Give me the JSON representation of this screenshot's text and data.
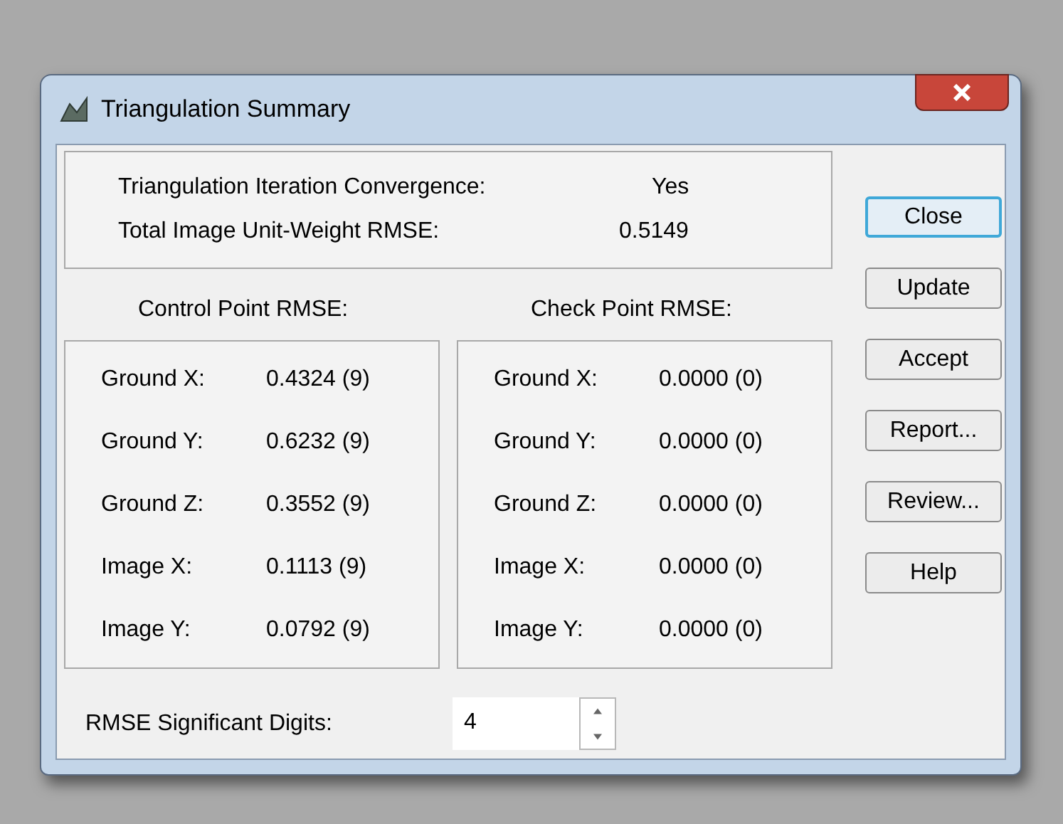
{
  "window": {
    "title": "Triangulation Summary"
  },
  "summary": [
    {
      "label": "Triangulation Iteration Convergence:",
      "value": "Yes"
    },
    {
      "label": "Total Image Unit-Weight RMSE:",
      "value": "0.5149"
    }
  ],
  "groups": [
    {
      "heading": "Control Point RMSE:",
      "rows": [
        {
          "label": "Ground X:",
          "value": "0.4324 (9)"
        },
        {
          "label": "Ground Y:",
          "value": "0.6232 (9)"
        },
        {
          "label": "Ground Z:",
          "value": "0.3552 (9)"
        },
        {
          "label": "Image X:",
          "value": "0.1113 (9)"
        },
        {
          "label": "Image Y:",
          "value": "0.0792 (9)"
        }
      ]
    },
    {
      "heading": "Check Point RMSE:",
      "rows": [
        {
          "label": "Ground X:",
          "value": "0.0000 (0)"
        },
        {
          "label": "Ground Y:",
          "value": "0.0000 (0)"
        },
        {
          "label": "Ground Z:",
          "value": "0.0000 (0)"
        },
        {
          "label": "Image X:",
          "value": "0.0000 (0)"
        },
        {
          "label": "Image Y:",
          "value": "0.0000 (0)"
        }
      ]
    }
  ],
  "buttons": [
    {
      "label": "Close",
      "default": true
    },
    {
      "label": "Update",
      "default": false
    },
    {
      "label": "Accept",
      "default": false
    },
    {
      "label": "Report...",
      "default": false
    },
    {
      "label": "Review...",
      "default": false
    },
    {
      "label": "Help",
      "default": false
    }
  ],
  "digits": {
    "label": "RMSE Significant Digits:",
    "value": "4"
  }
}
